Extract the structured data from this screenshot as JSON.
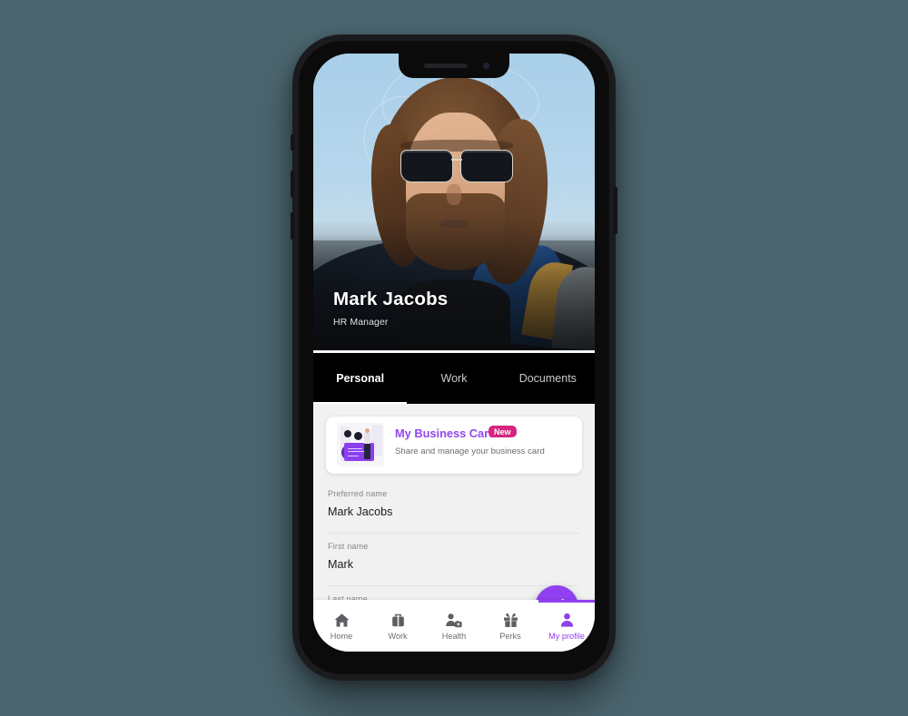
{
  "app": {
    "accent_purple": "#9040f0",
    "badge_pink": "#d6257e",
    "page_background": "#4c6670"
  },
  "profile": {
    "name": "Mark Jacobs",
    "role": "HR Manager",
    "photo_alt": "man-with-sunglasses-and-beard-portrait"
  },
  "tabs": [
    {
      "label": "Personal",
      "active": true
    },
    {
      "label": "Work",
      "active": false
    },
    {
      "label": "Documents",
      "active": false
    }
  ],
  "business_card": {
    "title": "My Business Card",
    "badge": "New",
    "subtitle": "Share and manage your business card",
    "illustration": "person-with-business-card-illustration"
  },
  "fields": [
    {
      "label": "Preferred name",
      "value": "Mark Jacobs"
    },
    {
      "label": "First name",
      "value": "Mark"
    },
    {
      "label": "Last name",
      "value": ""
    }
  ],
  "fab": {
    "icon": "pencil-icon",
    "label": "Edit"
  },
  "bottom_nav": [
    {
      "label": "Home",
      "icon": "home-icon",
      "active": false
    },
    {
      "label": "Work",
      "icon": "briefcase-icon",
      "active": false
    },
    {
      "label": "Health",
      "icon": "person-medical-bag-icon",
      "active": false
    },
    {
      "label": "Perks",
      "icon": "gift-icon",
      "active": false
    },
    {
      "label": "My profile",
      "icon": "person-icon",
      "active": true
    }
  ]
}
